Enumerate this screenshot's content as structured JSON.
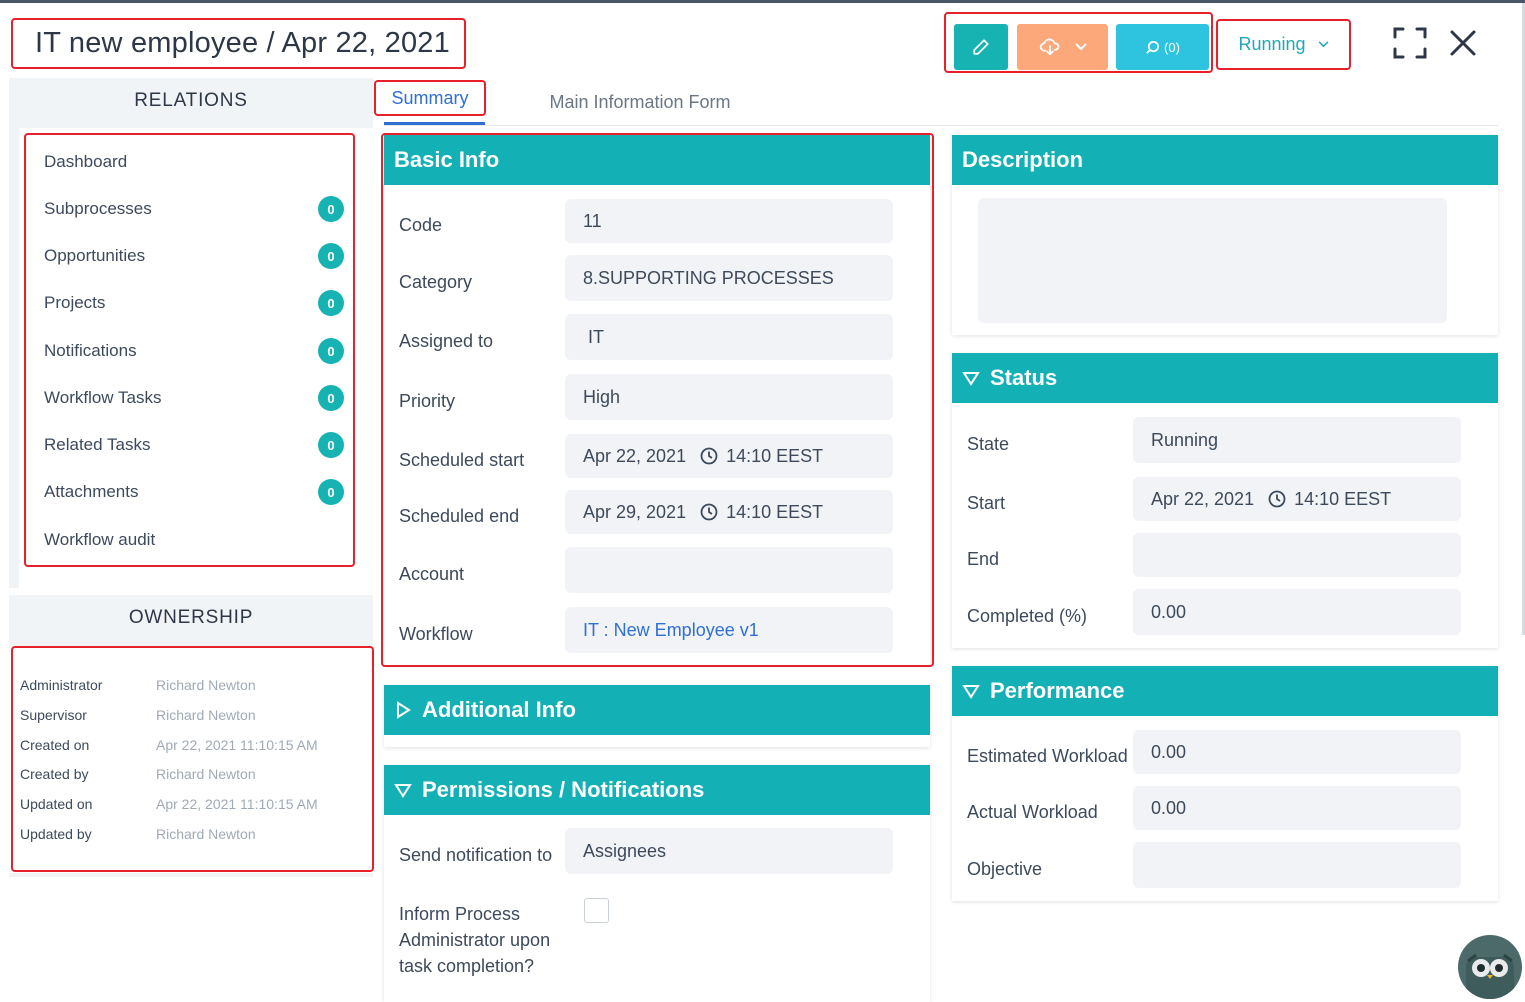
{
  "header": {
    "title": "IT new employee / Apr 22, 2021",
    "comments_label": "(0)",
    "status_label": "Running"
  },
  "tabs": {
    "summary": "Summary",
    "main_form": "Main Information Form"
  },
  "relations": {
    "heading": "RELATIONS",
    "items": [
      {
        "label": "Dashboard"
      },
      {
        "label": "Subprocesses",
        "count": "0"
      },
      {
        "label": "Opportunities",
        "count": "0"
      },
      {
        "label": "Projects",
        "count": "0"
      },
      {
        "label": "Notifications",
        "count": "0"
      },
      {
        "label": "Workflow Tasks",
        "count": "0"
      },
      {
        "label": "Related Tasks",
        "count": "0"
      },
      {
        "label": "Attachments",
        "count": "0"
      },
      {
        "label": "Workflow audit"
      }
    ]
  },
  "ownership": {
    "heading": "OWNERSHIP",
    "rows": [
      {
        "label": "Administrator",
        "value": "Richard Newton"
      },
      {
        "label": "Supervisor",
        "value": "Richard Newton"
      },
      {
        "label": "Created on",
        "value": "Apr 22, 2021 11:10:15 AM"
      },
      {
        "label": "Created by",
        "value": "Richard Newton"
      },
      {
        "label": "Updated on",
        "value": "Apr 22, 2021 11:10:15 AM"
      },
      {
        "label": "Updated by",
        "value": "Richard Newton"
      }
    ]
  },
  "basic_info": {
    "title": "Basic Info",
    "fields": [
      {
        "label": "Code",
        "value": "11"
      },
      {
        "label": "Category",
        "value": "8.SUPPORTING PROCESSES"
      },
      {
        "label": "Assigned to",
        "value": " IT"
      },
      {
        "label": "Priority",
        "value": "High"
      },
      {
        "label": "Scheduled start",
        "date": "Apr 22, 2021",
        "time": "14:10 EEST"
      },
      {
        "label": "Scheduled end",
        "date": "Apr 29, 2021",
        "time": "14:10 EEST"
      },
      {
        "label": "Account",
        "value": ""
      },
      {
        "label": "Workflow",
        "value": "IT : New Employee v1"
      }
    ]
  },
  "additional_info": {
    "title": "Additional Info"
  },
  "permissions": {
    "title": "Permissions / Notifications",
    "send_label": "Send notification to",
    "send_value": "Assignees",
    "inform_label_1": "Inform Process",
    "inform_label_2": "Administrator upon",
    "inform_label_3": "task completion?"
  },
  "description": {
    "title": "Description"
  },
  "status": {
    "title": "Status",
    "fields": [
      {
        "label": "State",
        "value": "Running"
      },
      {
        "label": "Start",
        "date": "Apr 22, 2021",
        "time": "14:10 EEST"
      },
      {
        "label": "End",
        "value": ""
      },
      {
        "label": "Completed (%)",
        "value": "0.00"
      }
    ]
  },
  "performance": {
    "title": "Performance",
    "fields": [
      {
        "label": "Estimated Workload",
        "value": "0.00"
      },
      {
        "label": "Actual Workload",
        "value": "0.00"
      },
      {
        "label": "Objective",
        "value": ""
      }
    ]
  },
  "colors": {
    "accent": "#13b0b5",
    "edit": "#17b3b3",
    "download": "#fda87a",
    "comments": "#2ec4e0",
    "highlight": "#e8202a",
    "link": "#2f6fd6"
  }
}
